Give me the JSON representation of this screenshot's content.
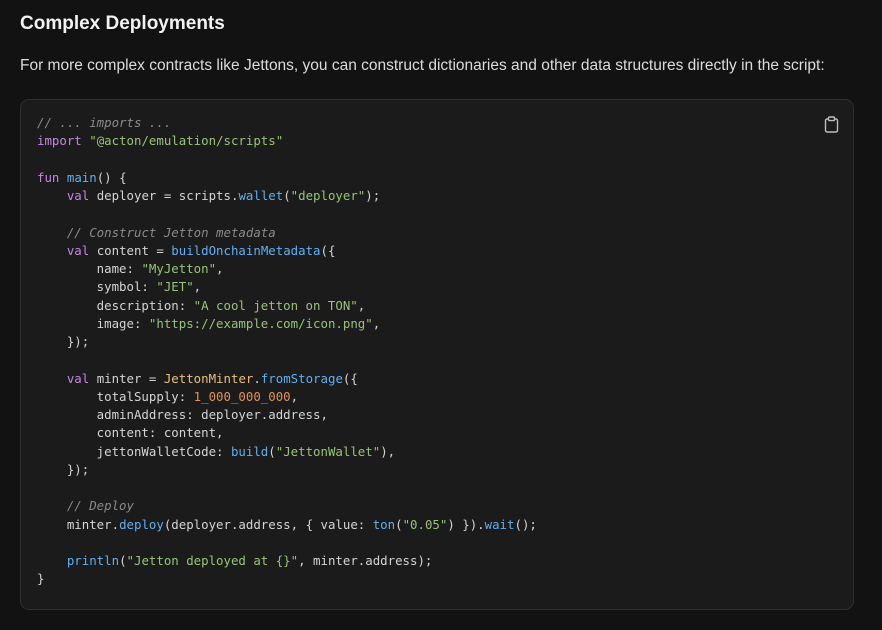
{
  "section": {
    "heading": "Complex Deployments",
    "intro": "For more complex contracts like Jettons, you can construct dictionaries and other data structures directly in the script:"
  },
  "code_block": {
    "copy_icon": "clipboard-icon",
    "lines": [
      [
        {
          "t": "// ... imports ...",
          "k": "comment"
        }
      ],
      [
        {
          "t": "import",
          "k": "keyword"
        },
        {
          "t": " ",
          "k": "plain"
        },
        {
          "t": "\"@acton/emulation/scripts\"",
          "k": "string"
        }
      ],
      [],
      [
        {
          "t": "fun",
          "k": "keyword"
        },
        {
          "t": " ",
          "k": "plain"
        },
        {
          "t": "main",
          "k": "func"
        },
        {
          "t": "() {",
          "k": "plain"
        }
      ],
      [
        {
          "t": "    ",
          "k": "plain"
        },
        {
          "t": "val",
          "k": "keyword"
        },
        {
          "t": " deployer = scripts.",
          "k": "plain"
        },
        {
          "t": "wallet",
          "k": "func"
        },
        {
          "t": "(",
          "k": "plain"
        },
        {
          "t": "\"deployer\"",
          "k": "string"
        },
        {
          "t": ");",
          "k": "plain"
        }
      ],
      [],
      [
        {
          "t": "    ",
          "k": "plain"
        },
        {
          "t": "// Construct Jetton metadata",
          "k": "comment"
        }
      ],
      [
        {
          "t": "    ",
          "k": "plain"
        },
        {
          "t": "val",
          "k": "keyword"
        },
        {
          "t": " content = ",
          "k": "plain"
        },
        {
          "t": "buildOnchainMetadata",
          "k": "func"
        },
        {
          "t": "({",
          "k": "plain"
        }
      ],
      [
        {
          "t": "        name: ",
          "k": "plain"
        },
        {
          "t": "\"MyJetton\"",
          "k": "string"
        },
        {
          "t": ",",
          "k": "plain"
        }
      ],
      [
        {
          "t": "        symbol: ",
          "k": "plain"
        },
        {
          "t": "\"JET\"",
          "k": "string"
        },
        {
          "t": ",",
          "k": "plain"
        }
      ],
      [
        {
          "t": "        description: ",
          "k": "plain"
        },
        {
          "t": "\"A cool jetton on TON\"",
          "k": "string"
        },
        {
          "t": ",",
          "k": "plain"
        }
      ],
      [
        {
          "t": "        image: ",
          "k": "plain"
        },
        {
          "t": "\"https://example.com/icon.png\"",
          "k": "string"
        },
        {
          "t": ",",
          "k": "plain"
        }
      ],
      [
        {
          "t": "    });",
          "k": "plain"
        }
      ],
      [],
      [
        {
          "t": "    ",
          "k": "plain"
        },
        {
          "t": "val",
          "k": "keyword"
        },
        {
          "t": " minter = ",
          "k": "plain"
        },
        {
          "t": "JettonMinter",
          "k": "type"
        },
        {
          "t": ".",
          "k": "plain"
        },
        {
          "t": "fromStorage",
          "k": "func"
        },
        {
          "t": "({",
          "k": "plain"
        }
      ],
      [
        {
          "t": "        totalSupply: ",
          "k": "plain"
        },
        {
          "t": "1_000_000_000",
          "k": "number"
        },
        {
          "t": ",",
          "k": "plain"
        }
      ],
      [
        {
          "t": "        adminAddress: deployer.address,",
          "k": "plain"
        }
      ],
      [
        {
          "t": "        content: content,",
          "k": "plain"
        }
      ],
      [
        {
          "t": "        jettonWalletCode: ",
          "k": "plain"
        },
        {
          "t": "build",
          "k": "func"
        },
        {
          "t": "(",
          "k": "plain"
        },
        {
          "t": "\"JettonWallet\"",
          "k": "string"
        },
        {
          "t": "),",
          "k": "plain"
        }
      ],
      [
        {
          "t": "    });",
          "k": "plain"
        }
      ],
      [],
      [
        {
          "t": "    ",
          "k": "plain"
        },
        {
          "t": "// Deploy",
          "k": "comment"
        }
      ],
      [
        {
          "t": "    minter.",
          "k": "plain"
        },
        {
          "t": "deploy",
          "k": "func"
        },
        {
          "t": "(deployer.address, { value: ",
          "k": "plain"
        },
        {
          "t": "ton",
          "k": "func"
        },
        {
          "t": "(",
          "k": "plain"
        },
        {
          "t": "\"0.05\"",
          "k": "string"
        },
        {
          "t": ") }).",
          "k": "plain"
        },
        {
          "t": "wait",
          "k": "func"
        },
        {
          "t": "();",
          "k": "plain"
        }
      ],
      [],
      [
        {
          "t": "    ",
          "k": "plain"
        },
        {
          "t": "println",
          "k": "func"
        },
        {
          "t": "(",
          "k": "plain"
        },
        {
          "t": "\"Jetton deployed at {}\"",
          "k": "string"
        },
        {
          "t": ", minter.address);",
          "k": "plain"
        }
      ],
      [
        {
          "t": "}",
          "k": "plain"
        }
      ]
    ]
  }
}
